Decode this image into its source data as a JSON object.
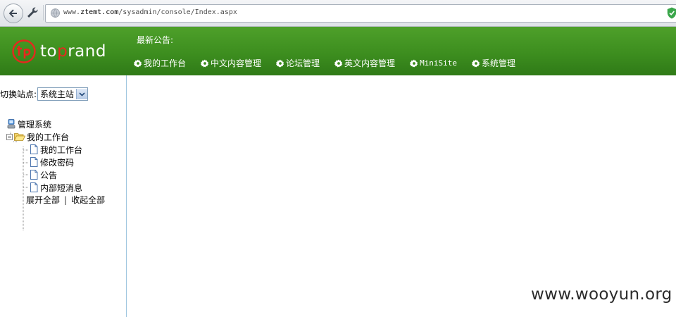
{
  "browser": {
    "url_prefix": "www.",
    "url_host": "ztemt.com",
    "url_path": "/sysadmin/console/Index.aspx"
  },
  "header": {
    "logo_text_a": "to",
    "logo_text_b": "p",
    "logo_text_c": "rand",
    "notice_label": "最新公告:",
    "nav": [
      {
        "label": "我的工作台",
        "icon": "gear-icon"
      },
      {
        "label": "中文内容管理",
        "icon": "gear-icon"
      },
      {
        "label": "论坛管理",
        "icon": "gear-icon"
      },
      {
        "label": "英文内容管理",
        "icon": "gear-icon"
      },
      {
        "label": "MiniSite",
        "icon": "gear-icon"
      },
      {
        "label": "系统管理",
        "icon": "gear-icon"
      }
    ],
    "colors": {
      "header_green": "#3d8e1f",
      "logo_red": "#e6281e"
    }
  },
  "sidebar": {
    "switch_label": "切换站点:",
    "switch_value": "系统主站",
    "tree": {
      "root": {
        "label": "管理系统",
        "icon": "computer-icon"
      },
      "folder": {
        "label": "我的工作台",
        "icon": "folder-open-icon"
      },
      "items": [
        {
          "label": "我的工作台",
          "icon": "page-icon"
        },
        {
          "label": "修改密码",
          "icon": "page-icon"
        },
        {
          "label": "公告",
          "icon": "page-icon"
        },
        {
          "label": "内部短消息",
          "icon": "page-icon"
        }
      ]
    },
    "expand_all": "展开全部",
    "divider": "|",
    "collapse_all": "收起全部"
  },
  "watermark": "www.wooyun.org"
}
